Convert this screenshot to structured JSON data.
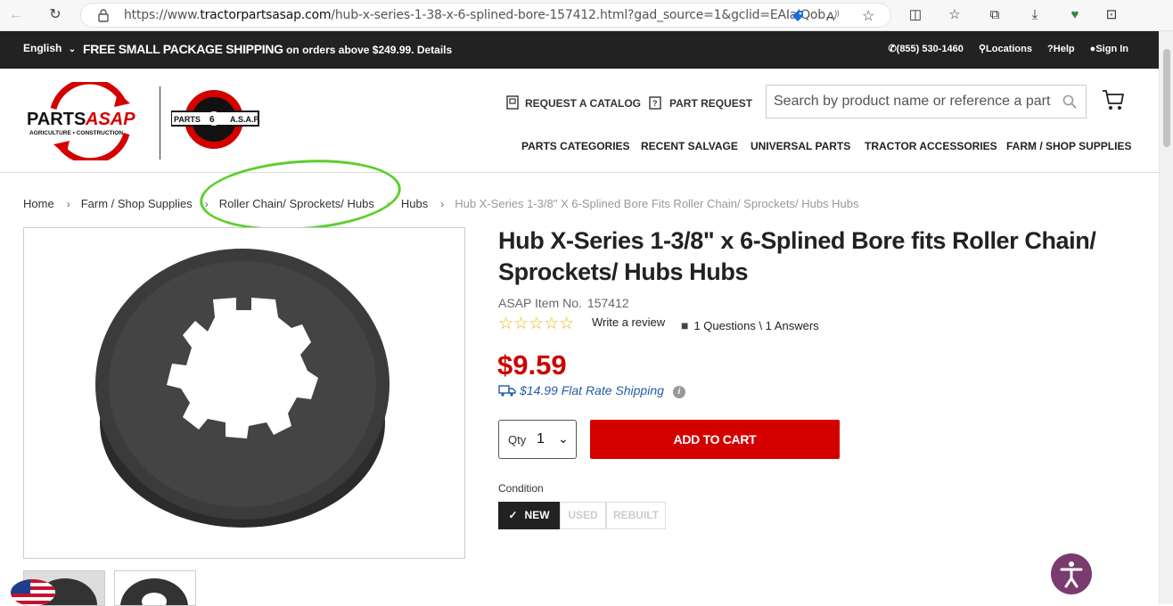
{
  "browser": {
    "url_prefix": "https://www.",
    "url_domain": "tractorpartsasap.com",
    "url_rest": "/hub-x-series-1-38-x-6-splined-bore-157412.html?gad_source=1&gclid=EAIaIQob..."
  },
  "promo": {
    "language": "English",
    "headline": "FREE SMALL PACKAGE SHIPPING",
    "subtext": "on orders above $249.99. Details",
    "phone": "(855) 530-1460",
    "locations": "Locations",
    "help": "Help",
    "sign_in": "Sign In"
  },
  "header": {
    "request_catalog": "REQUEST A CATALOG",
    "part_request": "PART  REQUEST",
    "search_placeholder": "Search by product name or reference a part",
    "nav": [
      "PARTS CATEGORIES",
      "RECENT SALVAGE",
      "UNIVERSAL PARTS",
      "TRACTOR ACCESSORIES",
      "FARM / SHOP SUPPLIES"
    ]
  },
  "breadcrumb": {
    "items": [
      "Home",
      "Farm / Shop Supplies",
      "Roller Chain/ Sprockets/ Hubs",
      "Hubs"
    ],
    "current": "Hub X-Series 1-3/8\" X 6-Splined Bore Fits Roller Chain/ Sprockets/ Hubs Hubs"
  },
  "product": {
    "title": "Hub X-Series 1-3/8\" x 6-Splined Bore fits Roller Chain/ Sprockets/ Hubs Hubs",
    "item_label": "ASAP Item No.",
    "item_number": "157412",
    "rating_stars": "☆☆☆☆☆",
    "write_review": "Write a review",
    "qa": "1 Questions \\ 1 Answers",
    "price": "$9.59",
    "shipping": "$14.99 Flat Rate Shipping",
    "qty_label": "Qty",
    "qty_value": "1",
    "add_to_cart": "ADD TO CART",
    "condition_label": "Condition",
    "conditions": [
      "NEW",
      "USED",
      "REBUILT"
    ]
  },
  "colors": {
    "brand_red": "#d40000",
    "price_red": "#cc0000",
    "shipping_blue": "#245ca8",
    "annotation_green": "#5ad02a"
  }
}
